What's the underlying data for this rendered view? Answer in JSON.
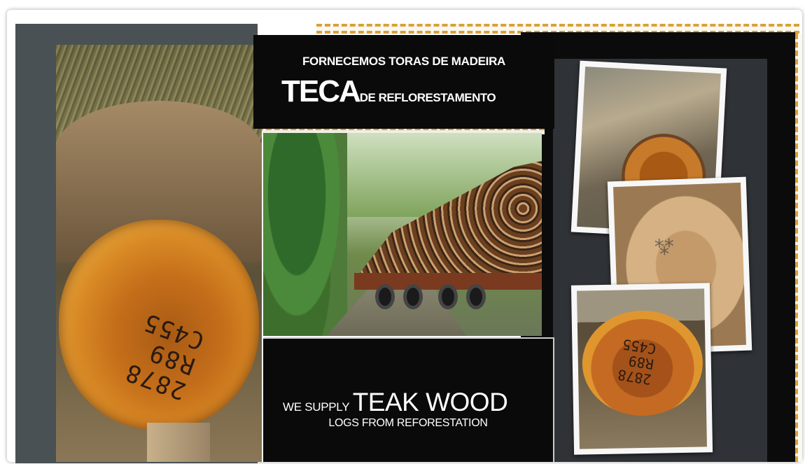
{
  "banner": {
    "title_top": "FORNECEMOS TORAS DE MADEIRA",
    "title_big": "TECA",
    "title_rest": "DE REFLORESTAMENTO",
    "en_small": "WE SUPPLY",
    "en_big": "TEAK WOOD",
    "en_line2": "LOGS FROM REFORESTATION"
  },
  "photos": {
    "left_log_ink": "2878\nR89\nC455",
    "polaroid3_ink": "2878\nR89\nC455"
  },
  "colors": {
    "accent_dash": "#d9a13a",
    "panel_black": "#0a0a0a",
    "panel_gray": "#4a5154"
  }
}
